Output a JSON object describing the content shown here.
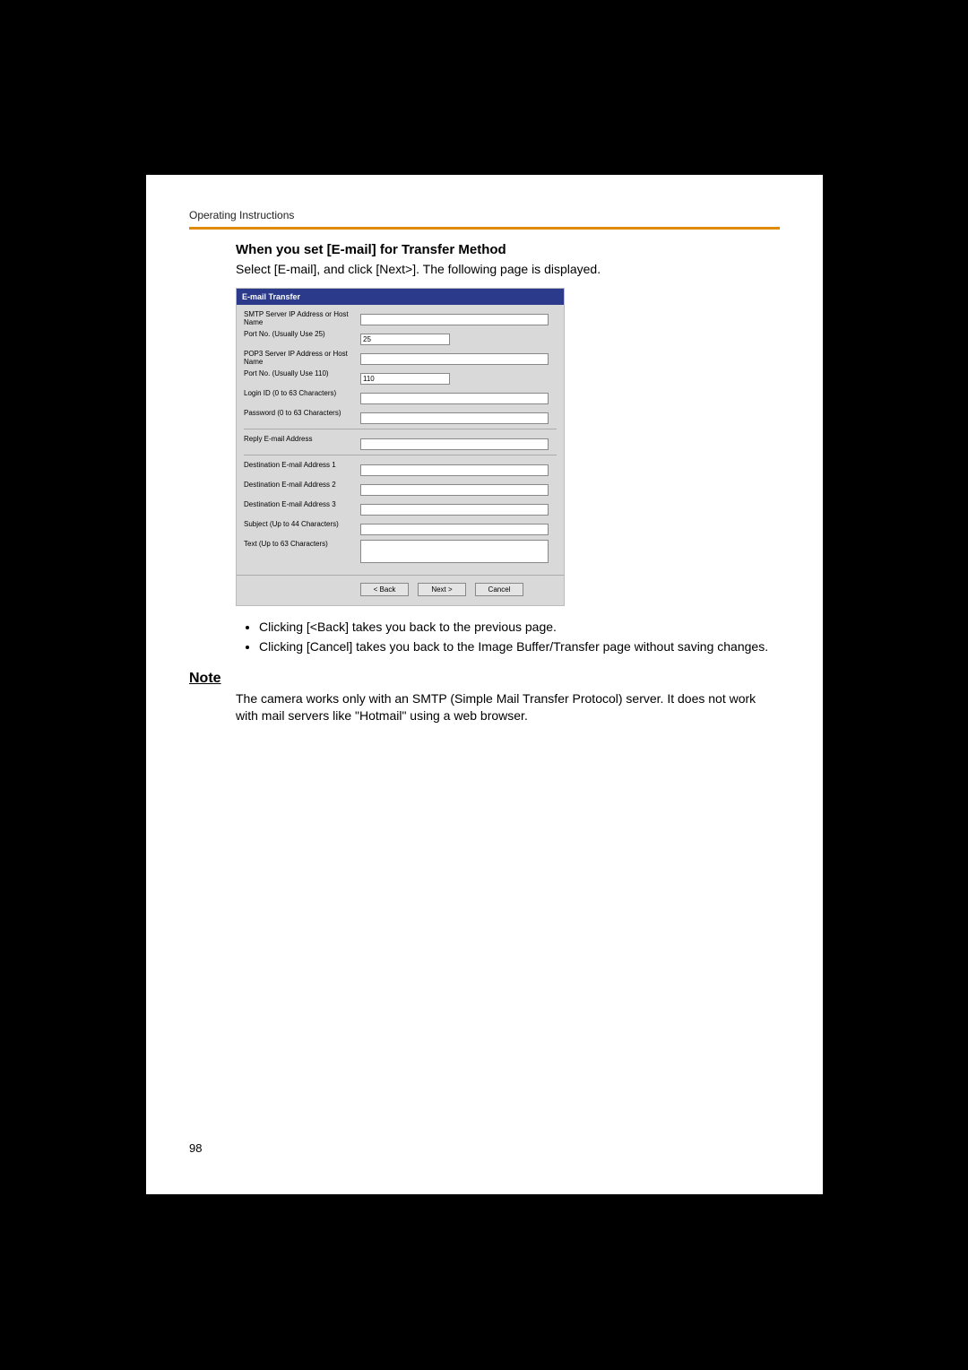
{
  "running_header": "Operating Instructions",
  "section_heading": "When you set [E-mail] for Transfer Method",
  "intro_text": "Select [E-mail], and click [Next>]. The following page is displayed.",
  "form": {
    "title": "E-mail Transfer",
    "labels": {
      "smtp": "SMTP Server IP Address or Host Name",
      "smtp_port": "Port No. (Usually Use 25)",
      "pop3": "POP3 Server IP Address or Host Name",
      "pop3_port": "Port No. (Usually Use 110)",
      "login": "Login ID (0 to 63 Characters)",
      "password": "Password (0 to 63 Characters)",
      "reply": "Reply E-mail Address",
      "dest1": "Destination E-mail Address 1",
      "dest2": "Destination E-mail Address 2",
      "dest3": "Destination E-mail Address 3",
      "subject": "Subject (Up to 44 Characters)",
      "text": "Text (Up to 63 Characters)"
    },
    "values": {
      "smtp_port": "25",
      "pop3_port": "110"
    },
    "buttons": {
      "back": "< Back",
      "next": "Next >",
      "cancel": "Cancel"
    }
  },
  "bullets": {
    "b1": "Clicking [<Back] takes you back to the previous page.",
    "b2": "Clicking [Cancel] takes you back to the Image Buffer/Transfer page without saving changes."
  },
  "note_heading": "Note",
  "note_text": "The camera works only with an SMTP (Simple Mail Transfer Protocol) server. It does not work with mail servers like \"Hotmail\" using a web browser.",
  "page_number": "98"
}
